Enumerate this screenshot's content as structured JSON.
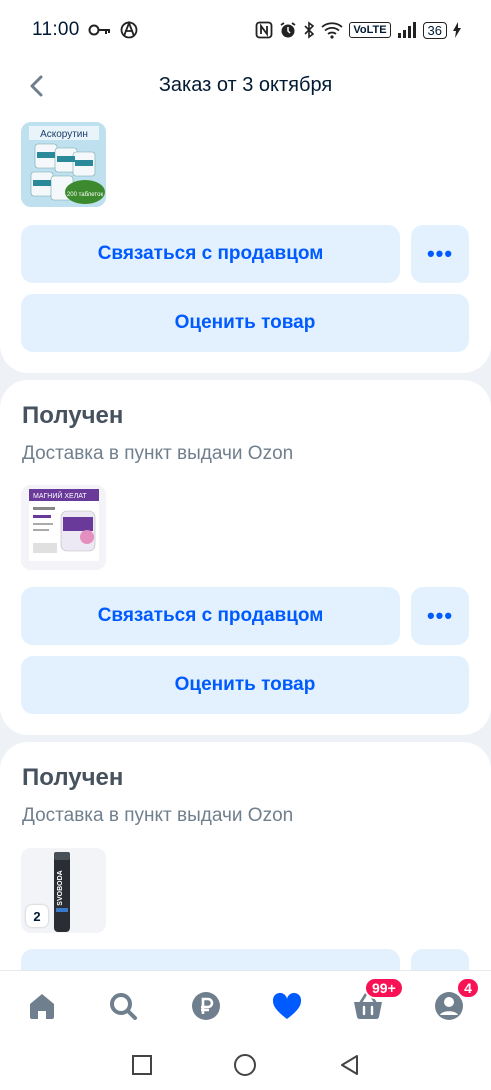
{
  "status_bar": {
    "time": "11:00",
    "volte": "VoLTE",
    "battery": "36"
  },
  "header": {
    "title": "Заказ от 3 октября"
  },
  "orders": [
    {
      "product_image_label": "Аскорутин",
      "product_image_sublabel": "200 таблеток",
      "contact_label": "Связаться с продавцом",
      "more_label": "•••",
      "rate_label": "Оценить товар"
    },
    {
      "status": "Получен",
      "delivery": "Доставка в пункт выдачи Ozon",
      "product_image_label": "МАГНИЙ ХЕЛАТ",
      "contact_label": "Связаться с продавцом",
      "more_label": "•••",
      "rate_label": "Оценить товар"
    },
    {
      "status": "Получен",
      "delivery": "Доставка в пункт выдачи Ozon",
      "product_image_label": "SVOBODA",
      "quantity": "2"
    }
  ],
  "bottom_nav": {
    "cart_badge": "99+",
    "profile_badge": "4"
  },
  "colors": {
    "accent": "#005bff",
    "button_bg": "#e3f1ff",
    "badge": "#f91155",
    "nav_icon": "#707f8d"
  }
}
